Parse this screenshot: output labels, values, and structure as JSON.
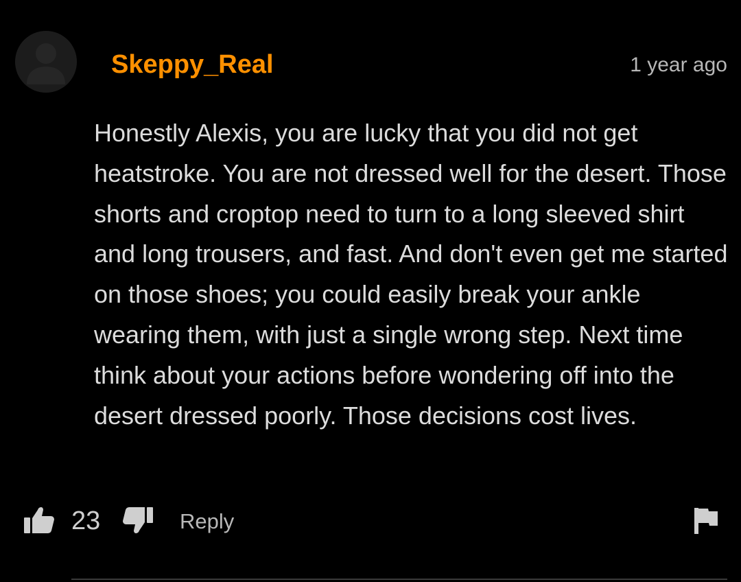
{
  "comment": {
    "author": "Skeppy_Real",
    "timestamp": "1 year ago",
    "body": "Honestly Alexis, you are lucky that you did not get heatstroke. You are not dressed well for the desert. Those shorts and croptop need to turn to a long sleeved shirt and long trousers, and fast. And don't even get me started on those shoes; you could easily break your ankle wearing them, with just a single wrong step. Next time think about your actions before wondering off into the desert dressed poorly. Those decisions cost lives.",
    "avatar_icon": "default-user-avatar-icon",
    "accent_color": "#ff9000"
  },
  "actions": {
    "like_icon": "thumbs-up-icon",
    "like_count": "23",
    "dislike_icon": "thumbs-down-icon",
    "reply_label": "Reply",
    "flag_icon": "flag-icon"
  }
}
